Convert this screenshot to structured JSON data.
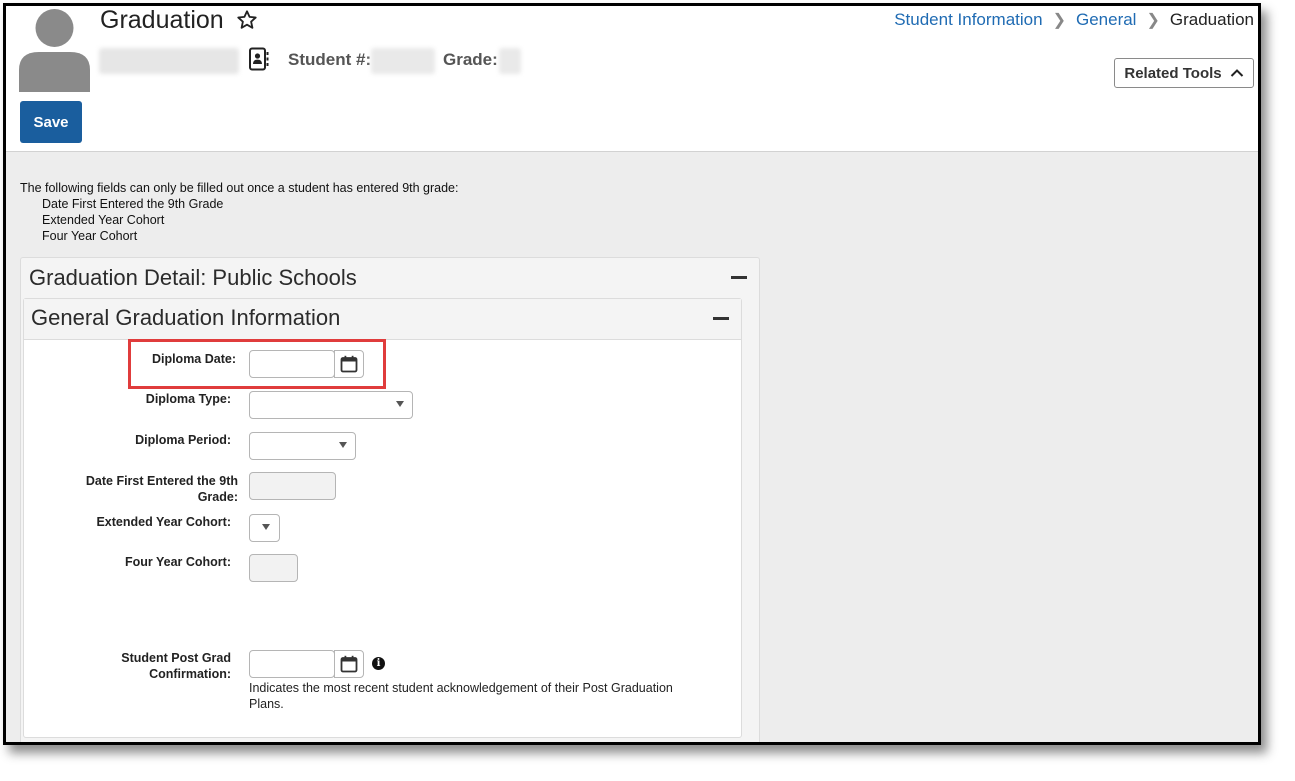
{
  "header": {
    "title": "Graduation",
    "student_label": "Student #:",
    "grade_label": "Grade:",
    "breadcrumb": [
      "Student Information",
      "General",
      "Graduation"
    ],
    "related_tools_label": "Related Tools"
  },
  "toolbar": {
    "save_label": "Save"
  },
  "notice": {
    "text": "The following fields can only be filled out once a student has entered 9th grade:",
    "items": [
      "Date First Entered the 9th Grade",
      "Extended Year Cohort",
      "Four Year Cohort"
    ]
  },
  "panels": {
    "outer_title": "Graduation Detail: Public Schools",
    "inner_title": "General Graduation Information"
  },
  "fields": {
    "diploma_date": {
      "label": "Diploma Date:",
      "value": ""
    },
    "diploma_type": {
      "label": "Diploma Type:",
      "value": ""
    },
    "diploma_period": {
      "label": "Diploma Period:",
      "value": ""
    },
    "date_first_9th": {
      "label_line1": "Date First Entered the 9th",
      "label_line2": "Grade:",
      "value": ""
    },
    "extended_year_cohort": {
      "label": "Extended Year Cohort:",
      "value": ""
    },
    "four_year_cohort": {
      "label": "Four Year Cohort:",
      "value": ""
    },
    "post_grad_confirmation": {
      "label_line1": "Student Post Grad",
      "label_line2": "Confirmation:",
      "value": "",
      "help_line1": "Indicates the most recent student acknowledgement of their Post Graduation",
      "help_line2": "Plans."
    }
  },
  "colors": {
    "accent": "#1a5e9e",
    "link": "#1f6bb3",
    "highlight": "#e03c3c"
  }
}
